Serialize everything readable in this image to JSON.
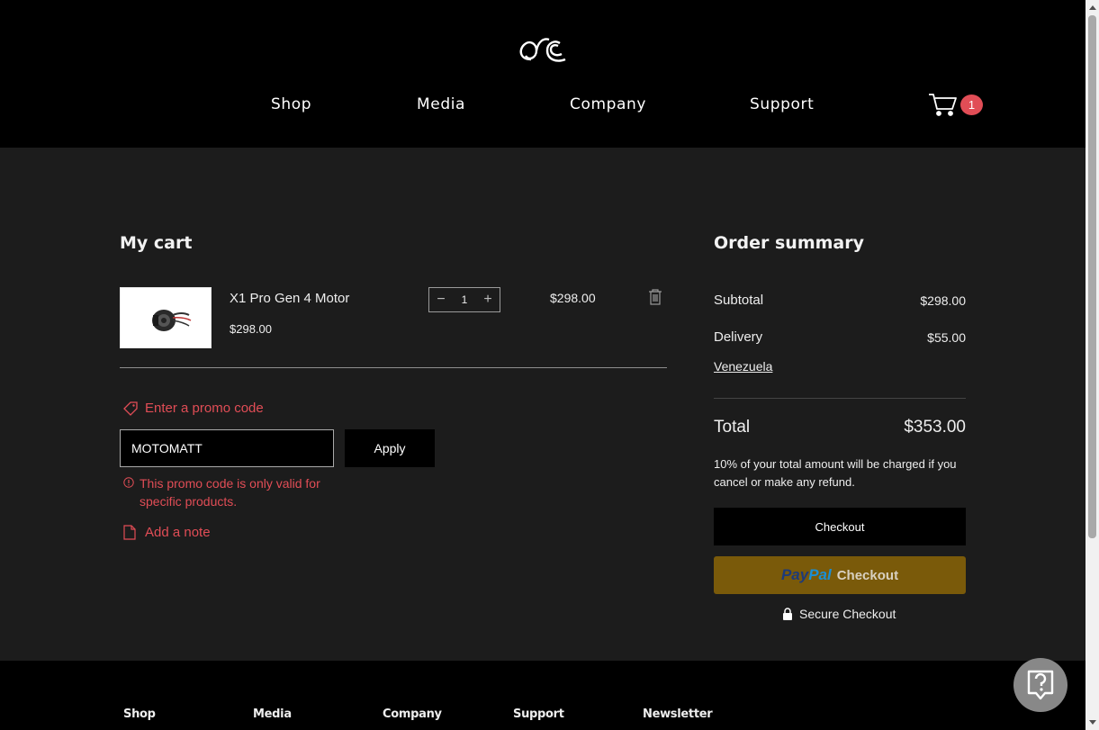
{
  "header": {
    "nav": [
      "Shop",
      "Media",
      "Company",
      "Support"
    ],
    "cart_count": "1"
  },
  "cart": {
    "title": "My cart",
    "item": {
      "name": "X1 Pro Gen 4 Motor",
      "unit_price": "$298.00",
      "quantity": "1",
      "line_total": "$298.00"
    },
    "promo": {
      "link_label": "Enter a promo code",
      "input_value": "MOTOMATT",
      "apply_label": "Apply",
      "error": "This promo code is only valid for specific products."
    },
    "note_label": "Add a note"
  },
  "summary": {
    "title": "Order summary",
    "subtotal_label": "Subtotal",
    "subtotal_value": "$298.00",
    "delivery_label": "Delivery",
    "delivery_value": "$55.00",
    "country": "Venezuela",
    "total_label": "Total",
    "total_value": "$353.00",
    "fee_note": "10% of your total amount will be charged if you cancel or make any refund.",
    "checkout_label": "Checkout",
    "paypal_word1": "Pay",
    "paypal_word2": "Pal",
    "paypal_checkout": "Checkout",
    "secure_label": "Secure Checkout"
  },
  "footer": {
    "columns": [
      "Shop",
      "Media",
      "Company",
      "Support",
      "Newsletter"
    ]
  },
  "colors": {
    "accent_red": "#e14d56",
    "paypal_gold": "#7a5a0a",
    "background": "#1c1c1c",
    "header_bg": "#000000"
  }
}
